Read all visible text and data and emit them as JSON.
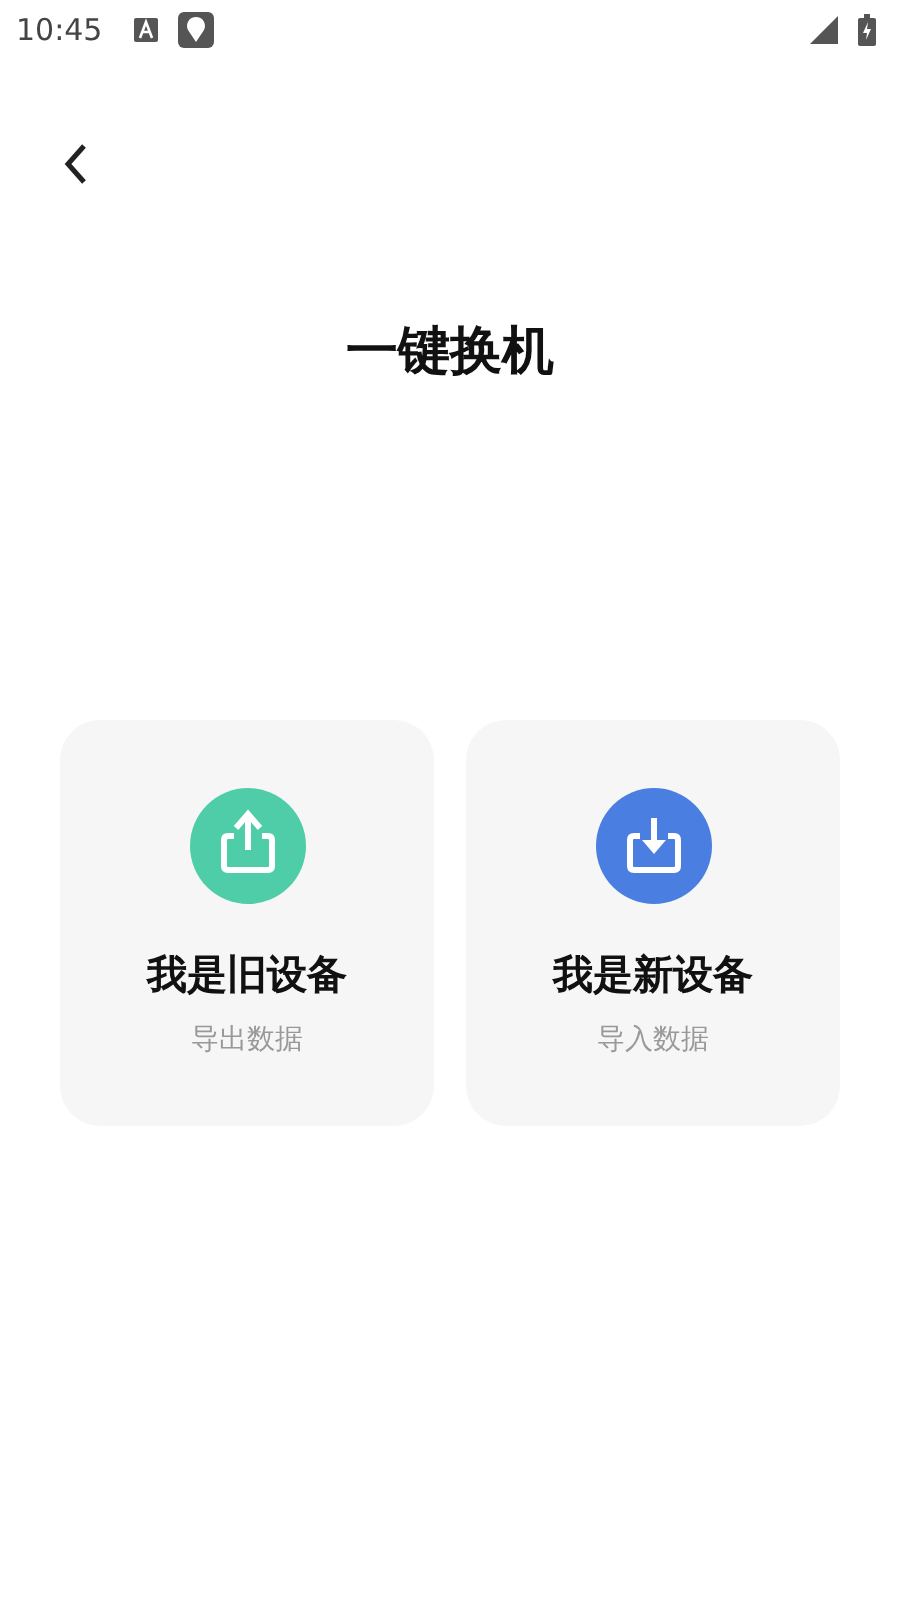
{
  "status_bar": {
    "time": "10:45"
  },
  "title": "一键换机",
  "options": [
    {
      "kind": "export",
      "color": "#4ecda8",
      "title": "我是旧设备",
      "subtitle": "导出数据"
    },
    {
      "kind": "import",
      "color": "#4a7ee0",
      "title": "我是新设备",
      "subtitle": "导入数据"
    }
  ]
}
